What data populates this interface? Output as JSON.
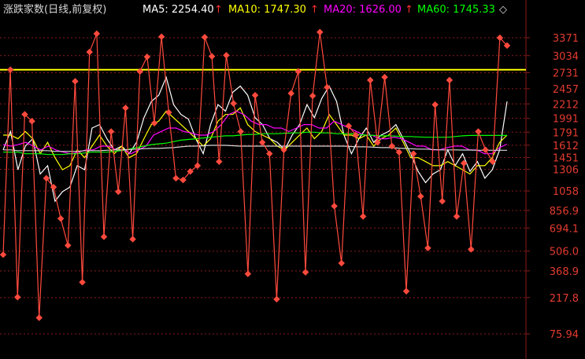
{
  "header": {
    "title": "涨跌家数(日线,前复权)",
    "ma": [
      {
        "label": "MA5: 2254.40",
        "arrow": "↑",
        "color": "#ffffff"
      },
      {
        "label": "MA10: 1747.30",
        "arrow": "↑",
        "color": "#ffff00"
      },
      {
        "label": "MA20: 1626.00",
        "arrow": "↑",
        "color": "#ff00ff"
      },
      {
        "label": "MA60: 1745.33",
        "arrow": "◇",
        "color": "#00ff00"
      }
    ]
  },
  "colors": {
    "background": "#000000",
    "grid": "#8b1a1a",
    "axis_text": "#e23b30",
    "main_series": "#ff4a3d",
    "reference_line": "#ffff00"
  },
  "chart_data": {
    "type": "line",
    "title": "涨跌家数(日线,前复权)",
    "y_ticks": [
      "3371",
      "3034",
      "2731",
      "2457",
      "2212",
      "1991",
      "1791",
      "1612",
      "1451",
      "1306",
      "1058",
      "856.9",
      "694.1",
      "506.0",
      "368.9",
      "217.8",
      "75.94"
    ],
    "y_scale": "sqrt",
    "ylim": [
      0,
      3680
    ],
    "x_count": 84,
    "reference_line": 2780,
    "grid": true,
    "series": [
      {
        "name": "涨跌家数",
        "color": "#ff4a3d",
        "markers": true,
        "values": [
          480,
          2780,
          220,
          2050,
          1950,
          130,
          1200,
          1100,
          780,
          550,
          2580,
          300,
          3100,
          3450,
          620,
          1800,
          1050,
          2150,
          600,
          2750,
          3010,
          1920,
          3390,
          2080,
          1200,
          1180,
          1280,
          1350,
          3380,
          3020,
          1400,
          3040,
          2220,
          1800,
          350,
          2350,
          1650,
          1500,
          210,
          1550,
          2380,
          2750,
          360,
          2340,
          3480,
          2480,
          900,
          420,
          1880,
          1750,
          800,
          2600,
          1650,
          2650,
          1600,
          1520,
          250,
          1500,
          1000,
          530,
          2200,
          950,
          2600,
          800,
          1380,
          520,
          1800,
          1550,
          1400,
          3370,
          3220
        ],
        "x_start": 0
      },
      {
        "name": "MA5",
        "color": "#ffffff",
        "values": [
          1550,
          1800,
          1300,
          1600,
          1700,
          1250,
          1350,
          950,
          1050,
          1100,
          1350,
          1300,
          1850,
          1900,
          1700,
          1550,
          1600,
          1500,
          1650,
          2000,
          2250,
          2350,
          2650,
          2200,
          2050,
          1980,
          1700,
          1500,
          1900,
          2200,
          2100,
          2400,
          2500,
          2350,
          2000,
          1900,
          1700,
          1650,
          1550,
          1750,
          1900,
          2200,
          2000,
          2300,
          2500,
          2250,
          1750,
          1500,
          1700,
          1850,
          1650,
          1750,
          1800,
          1900,
          1700,
          1500,
          1280,
          1150,
          1250,
          1300,
          1550,
          1350,
          1500,
          1280,
          1400,
          1200,
          1300,
          1550,
          2250
        ],
        "x_start": 0
      },
      {
        "name": "MA10",
        "color": "#ffff00",
        "values": [
          1750,
          1750,
          1700,
          1800,
          1700,
          1500,
          1650,
          1450,
          1300,
          1350,
          1550,
          1450,
          1600,
          1750,
          1600,
          1500,
          1600,
          1450,
          1500,
          1700,
          1900,
          1950,
          2100,
          2000,
          1900,
          1800,
          1700,
          1600,
          1700,
          1950,
          2050,
          2050,
          2150,
          1900,
          1800,
          1750,
          1700,
          1600,
          1550,
          1650,
          1750,
          1850,
          1700,
          1800,
          2050,
          1900,
          1750,
          1750,
          1700,
          1750,
          1600,
          1700,
          1750,
          1850,
          1650,
          1450,
          1450,
          1400,
          1350,
          1350,
          1400,
          1350,
          1300,
          1250,
          1350,
          1350,
          1450,
          1650,
          1750
        ],
        "x_start": 0
      },
      {
        "name": "MA20",
        "color": "#ff00ff",
        "values": [
          1620,
          1600,
          1620,
          1650,
          1600,
          1550,
          1600,
          1550,
          1520,
          1500,
          1520,
          1550,
          1550,
          1600,
          1600,
          1550,
          1550,
          1500,
          1550,
          1600,
          1750,
          1800,
          1850,
          1850,
          1800,
          1780,
          1750,
          1750,
          1800,
          1900,
          2050,
          2100,
          2050,
          1950,
          1900,
          1900,
          1850,
          1850,
          1800,
          1850,
          1900,
          1900,
          1850,
          1850,
          1950,
          1900,
          1850,
          1800,
          1750,
          1750,
          1700,
          1700,
          1720,
          1700,
          1650,
          1600,
          1600,
          1550,
          1550,
          1580,
          1600,
          1600,
          1550,
          1550,
          1500,
          1500,
          1580,
          1626
        ],
        "x_start": 0
      },
      {
        "name": "MA60",
        "color": "#00ff00",
        "values": [
          1520,
          1520,
          1520,
          1500,
          1500,
          1500,
          1490,
          1490,
          1490,
          1500,
          1500,
          1510,
          1520,
          1520,
          1520,
          1530,
          1540,
          1560,
          1580,
          1600,
          1620,
          1630,
          1640,
          1660,
          1680,
          1690,
          1700,
          1710,
          1720,
          1730,
          1740,
          1740,
          1750,
          1760,
          1760,
          1770,
          1770,
          1770,
          1775,
          1780,
          1780,
          1790,
          1790,
          1780,
          1780,
          1770,
          1770,
          1770,
          1760,
          1750,
          1745,
          1740,
          1740,
          1735,
          1730,
          1730,
          1725,
          1720,
          1720,
          1720,
          1720,
          1730,
          1740,
          1745,
          1745,
          1745,
          1745,
          1745,
          1745
        ],
        "x_start": 0
      },
      {
        "name": "MA120",
        "color": "#d8d8d8",
        "values": [
          1550,
          1550,
          1540,
          1540,
          1540,
          1540,
          1540,
          1530,
          1530,
          1530,
          1530,
          1540,
          1540,
          1540,
          1545,
          1550,
          1550,
          1555,
          1560,
          1565,
          1570,
          1570,
          1575,
          1580,
          1590,
          1600,
          1600,
          1605,
          1610,
          1610,
          1610,
          1605,
          1600,
          1600,
          1600,
          1600,
          1600,
          1600,
          1600,
          1600,
          1600,
          1600,
          1600,
          1600,
          1600,
          1600,
          1600,
          1595,
          1590,
          1590,
          1585,
          1580,
          1580,
          1575,
          1570,
          1565,
          1560,
          1560,
          1555,
          1550,
          1550,
          1550,
          1548,
          1548,
          1545,
          1545,
          1545,
          1545,
          1545
        ],
        "x_start": 0
      }
    ]
  }
}
